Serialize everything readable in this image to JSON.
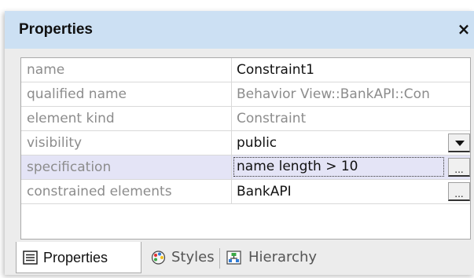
{
  "panel": {
    "title": "Properties",
    "close_label": "×"
  },
  "properties": [
    {
      "name": "name",
      "value": "Constraint1"
    },
    {
      "name": "qualified name",
      "value": "Behavior View::BankAPI::Con"
    },
    {
      "name": "element kind",
      "value": "Constraint"
    },
    {
      "name": "visibility",
      "value": "public"
    },
    {
      "name": "specification",
      "value": "name length > 10"
    },
    {
      "name": "constrained elements",
      "value": "BankAPI"
    }
  ],
  "buttons": {
    "ellipsis": "...",
    "visibility_dropdown_icon": "dropdown-arrow-icon"
  },
  "tabs": [
    {
      "label": "Properties",
      "icon": "properties-icon",
      "active": true
    },
    {
      "label": "Styles",
      "icon": "palette-icon",
      "active": false
    },
    {
      "label": "Hierarchy",
      "icon": "hierarchy-icon",
      "active": false
    }
  ],
  "colors": {
    "title_bar": "#cce0f3",
    "selected_row": "#e4e4f6",
    "panel_bg": "#ececec"
  }
}
